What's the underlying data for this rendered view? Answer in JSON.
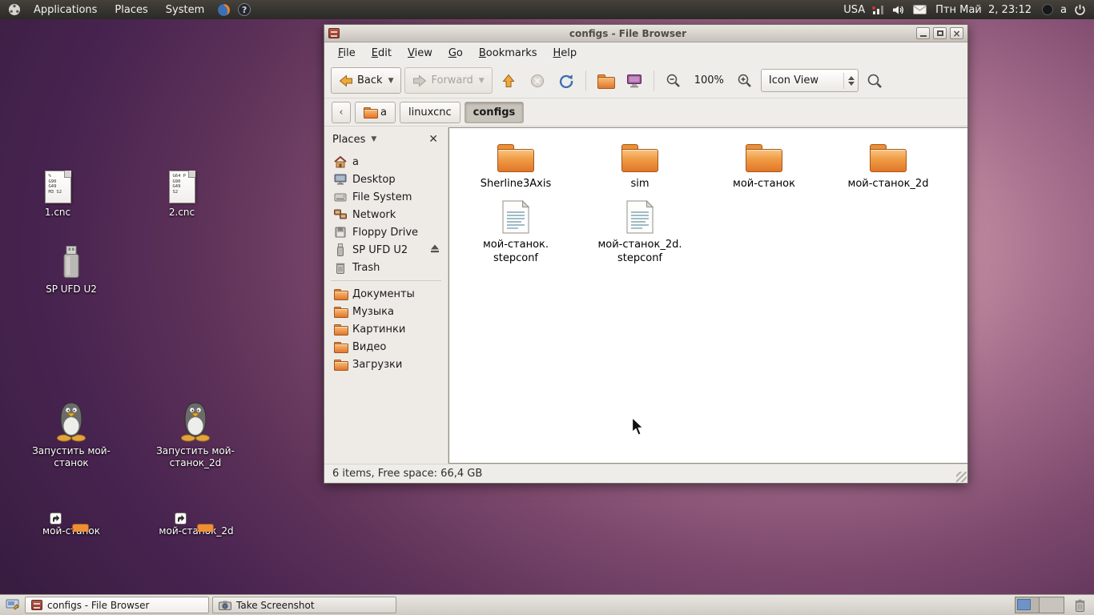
{
  "top_panel": {
    "menus": [
      {
        "label": "Applications"
      },
      {
        "label": "Places"
      },
      {
        "label": "System"
      }
    ],
    "keyboard_layout": "USA",
    "clock": "Птн Май  2, 23:12",
    "user": "a"
  },
  "desktop": {
    "icons": [
      {
        "label": "1.cnc",
        "type": "gcode-file",
        "icon_text": "%\nG90\nG49\nM3 S2"
      },
      {
        "label": "2.cnc",
        "type": "gcode-file",
        "icon_text": "G64 P\nG90\nG49\nS2"
      },
      {
        "label": "SP UFD U2",
        "type": "usb-drive"
      },
      {
        "label": "Запустить мой-\nстанок",
        "type": "launcher"
      },
      {
        "label": "Запустить мой-\nстанок_2d",
        "type": "launcher"
      },
      {
        "label": "мой-станок",
        "type": "folder-link"
      },
      {
        "label": "мой-станок_2d",
        "type": "folder-link"
      }
    ]
  },
  "window": {
    "title": "configs - File Browser",
    "menubar": [
      {
        "label": "File"
      },
      {
        "label": "Edit"
      },
      {
        "label": "View"
      },
      {
        "label": "Go"
      },
      {
        "label": "Bookmarks"
      },
      {
        "label": "Help"
      }
    ],
    "toolbar": {
      "back_label": "Back",
      "forward_label": "Forward",
      "zoom_level": "100%",
      "view_mode": "Icon View"
    },
    "breadcrumbs": [
      {
        "label": "a"
      },
      {
        "label": "linuxcnc"
      },
      {
        "label": "configs"
      }
    ],
    "sidebar": {
      "title": "Places",
      "items": [
        {
          "label": "a"
        },
        {
          "label": "Desktop"
        },
        {
          "label": "File System"
        },
        {
          "label": "Network"
        },
        {
          "label": "Floppy Drive"
        },
        {
          "label": "SP UFD U2"
        },
        {
          "label": "Trash"
        },
        {
          "label": "Документы"
        },
        {
          "label": "Музыка"
        },
        {
          "label": "Картинки"
        },
        {
          "label": "Видео"
        },
        {
          "label": "Загрузки"
        }
      ]
    },
    "files": [
      {
        "name": "Sherline3Axis",
        "type": "folder"
      },
      {
        "name": "sim",
        "type": "folder"
      },
      {
        "name": "мой-станок",
        "type": "folder"
      },
      {
        "name": "мой-станок_2d",
        "type": "folder"
      },
      {
        "name": "мой-станок.\nstepconf",
        "type": "stepconf"
      },
      {
        "name": "мой-станок_2d.\nstepconf",
        "type": "stepconf"
      }
    ],
    "statusbar": "6 items, Free space: 66,4 GB"
  },
  "taskbar": {
    "tasks": [
      {
        "label": "configs - File Browser"
      },
      {
        "label": "Take Screenshot"
      }
    ]
  }
}
